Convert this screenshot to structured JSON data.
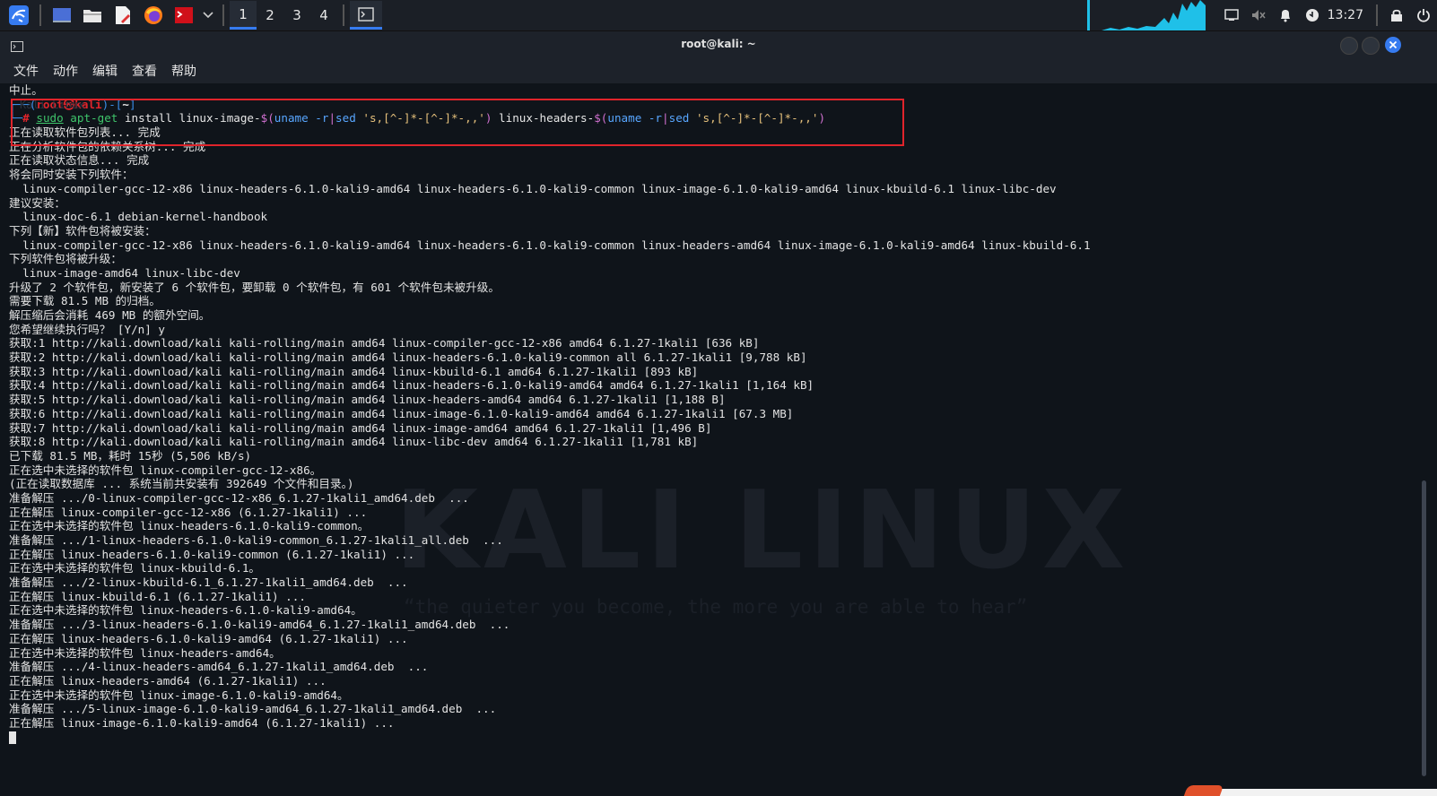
{
  "taskbar": {
    "workspaces": [
      "1",
      "2",
      "3",
      "4"
    ],
    "active_workspace": 0,
    "clock": "13:27",
    "launcher_icons": [
      "kali-menu-icon",
      "desktop-icon",
      "file-manager-icon",
      "text-editor-icon",
      "firefox-icon",
      "terminal-red-icon",
      "chevron-down-icon"
    ],
    "tray_icons": [
      "screen-icon",
      "volume-muted-icon",
      "bell-icon",
      "update-icon",
      "lock-icon",
      "power-icon"
    ],
    "colors": {
      "accent": "#367bf0",
      "cpu_graph": "#1fc0e8"
    }
  },
  "window": {
    "title": "root@kali: ~",
    "menu": [
      "文件",
      "动作",
      "编辑",
      "查看",
      "帮助"
    ]
  },
  "terminal": {
    "watermark": "KALI LINUX",
    "watermark_sub": "“the quieter you become, the more you are able to hear”",
    "pre_line": "中止。",
    "pre_line_faint": "Kali Linux",
    "prompt": {
      "open": "┌──(",
      "user_host": "root㉿kali",
      "mid": ")-[",
      "path": "~",
      "close": "]",
      "hash_prefix": "└─",
      "hash": "#"
    },
    "command": {
      "sudo": "sudo",
      "aptget": "apt-get",
      "rest1": " install linux-image-",
      "sub1_open": "$(",
      "sub1_cmd": "uname -r",
      "pipe1": "|",
      "sed1": "sed",
      "arg1": " 's,[^-]*-[^-]*-,,'",
      "sub1_close": ")",
      "rest2": " linux-headers-",
      "sub2_open": "$(",
      "sub2_cmd": "uname -r",
      "pipe2": "|",
      "sed2": "sed",
      "arg2": " 's,[^-]*-[^-]*-,,'",
      "sub2_close": ")"
    },
    "output": [
      "正在读取软件包列表... 完成",
      "正在分析软件包的依赖关系树... 完成",
      "正在读取状态信息... 完成",
      "将会同时安装下列软件：",
      "  linux-compiler-gcc-12-x86 linux-headers-6.1.0-kali9-amd64 linux-headers-6.1.0-kali9-common linux-image-6.1.0-kali9-amd64 linux-kbuild-6.1 linux-libc-dev",
      "建议安装：",
      "  linux-doc-6.1 debian-kernel-handbook",
      "下列【新】软件包将被安装：",
      "  linux-compiler-gcc-12-x86 linux-headers-6.1.0-kali9-amd64 linux-headers-6.1.0-kali9-common linux-headers-amd64 linux-image-6.1.0-kali9-amd64 linux-kbuild-6.1",
      "下列软件包将被升级：",
      "  linux-image-amd64 linux-libc-dev",
      "升级了 2 个软件包，新安装了 6 个软件包，要卸载 0 个软件包，有 601 个软件包未被升级。",
      "需要下载 81.5 MB 的归档。",
      "解压缩后会消耗 469 MB 的额外空间。",
      "您希望继续执行吗？ [Y/n] y",
      "获取:1 http://kali.download/kali kali-rolling/main amd64 linux-compiler-gcc-12-x86 amd64 6.1.27-1kali1 [636 kB]",
      "获取:2 http://kali.download/kali kali-rolling/main amd64 linux-headers-6.1.0-kali9-common all 6.1.27-1kali1 [9,788 kB]",
      "获取:3 http://kali.download/kali kali-rolling/main amd64 linux-kbuild-6.1 amd64 6.1.27-1kali1 [893 kB]",
      "获取:4 http://kali.download/kali kali-rolling/main amd64 linux-headers-6.1.0-kali9-amd64 amd64 6.1.27-1kali1 [1,164 kB]",
      "获取:5 http://kali.download/kali kali-rolling/main amd64 linux-headers-amd64 amd64 6.1.27-1kali1 [1,188 B]",
      "获取:6 http://kali.download/kali kali-rolling/main amd64 linux-image-6.1.0-kali9-amd64 amd64 6.1.27-1kali1 [67.3 MB]",
      "获取:7 http://kali.download/kali kali-rolling/main amd64 linux-image-amd64 amd64 6.1.27-1kali1 [1,496 B]",
      "获取:8 http://kali.download/kali kali-rolling/main amd64 linux-libc-dev amd64 6.1.27-1kali1 [1,781 kB]",
      "已下载 81.5 MB，耗时 15秒 (5,506 kB/s)",
      "正在选中未选择的软件包 linux-compiler-gcc-12-x86。",
      "(正在读取数据库 ... 系统当前共安装有 392649 个文件和目录。)",
      "准备解压 .../0-linux-compiler-gcc-12-x86_6.1.27-1kali1_amd64.deb  ...",
      "正在解压 linux-compiler-gcc-12-x86 (6.1.27-1kali1) ...",
      "正在选中未选择的软件包 linux-headers-6.1.0-kali9-common。",
      "准备解压 .../1-linux-headers-6.1.0-kali9-common_6.1.27-1kali1_all.deb  ...",
      "正在解压 linux-headers-6.1.0-kali9-common (6.1.27-1kali1) ...",
      "正在选中未选择的软件包 linux-kbuild-6.1。",
      "准备解压 .../2-linux-kbuild-6.1_6.1.27-1kali1_amd64.deb  ...",
      "正在解压 linux-kbuild-6.1 (6.1.27-1kali1) ...",
      "正在选中未选择的软件包 linux-headers-6.1.0-kali9-amd64。",
      "准备解压 .../3-linux-headers-6.1.0-kali9-amd64_6.1.27-1kali1_amd64.deb  ...",
      "正在解压 linux-headers-6.1.0-kali9-amd64 (6.1.27-1kali1) ...",
      "正在选中未选择的软件包 linux-headers-amd64。",
      "准备解压 .../4-linux-headers-amd64_6.1.27-1kali1_amd64.deb  ...",
      "正在解压 linux-headers-amd64 (6.1.27-1kali1) ...",
      "正在选中未选择的软件包 linux-image-6.1.0-kali9-amd64。",
      "准备解压 .../5-linux-image-6.1.0-kali9-amd64_6.1.27-1kali1_amd64.deb  ...",
      "正在解压 linux-image-6.1.0-kali9-amd64 (6.1.27-1kali1) ..."
    ]
  }
}
